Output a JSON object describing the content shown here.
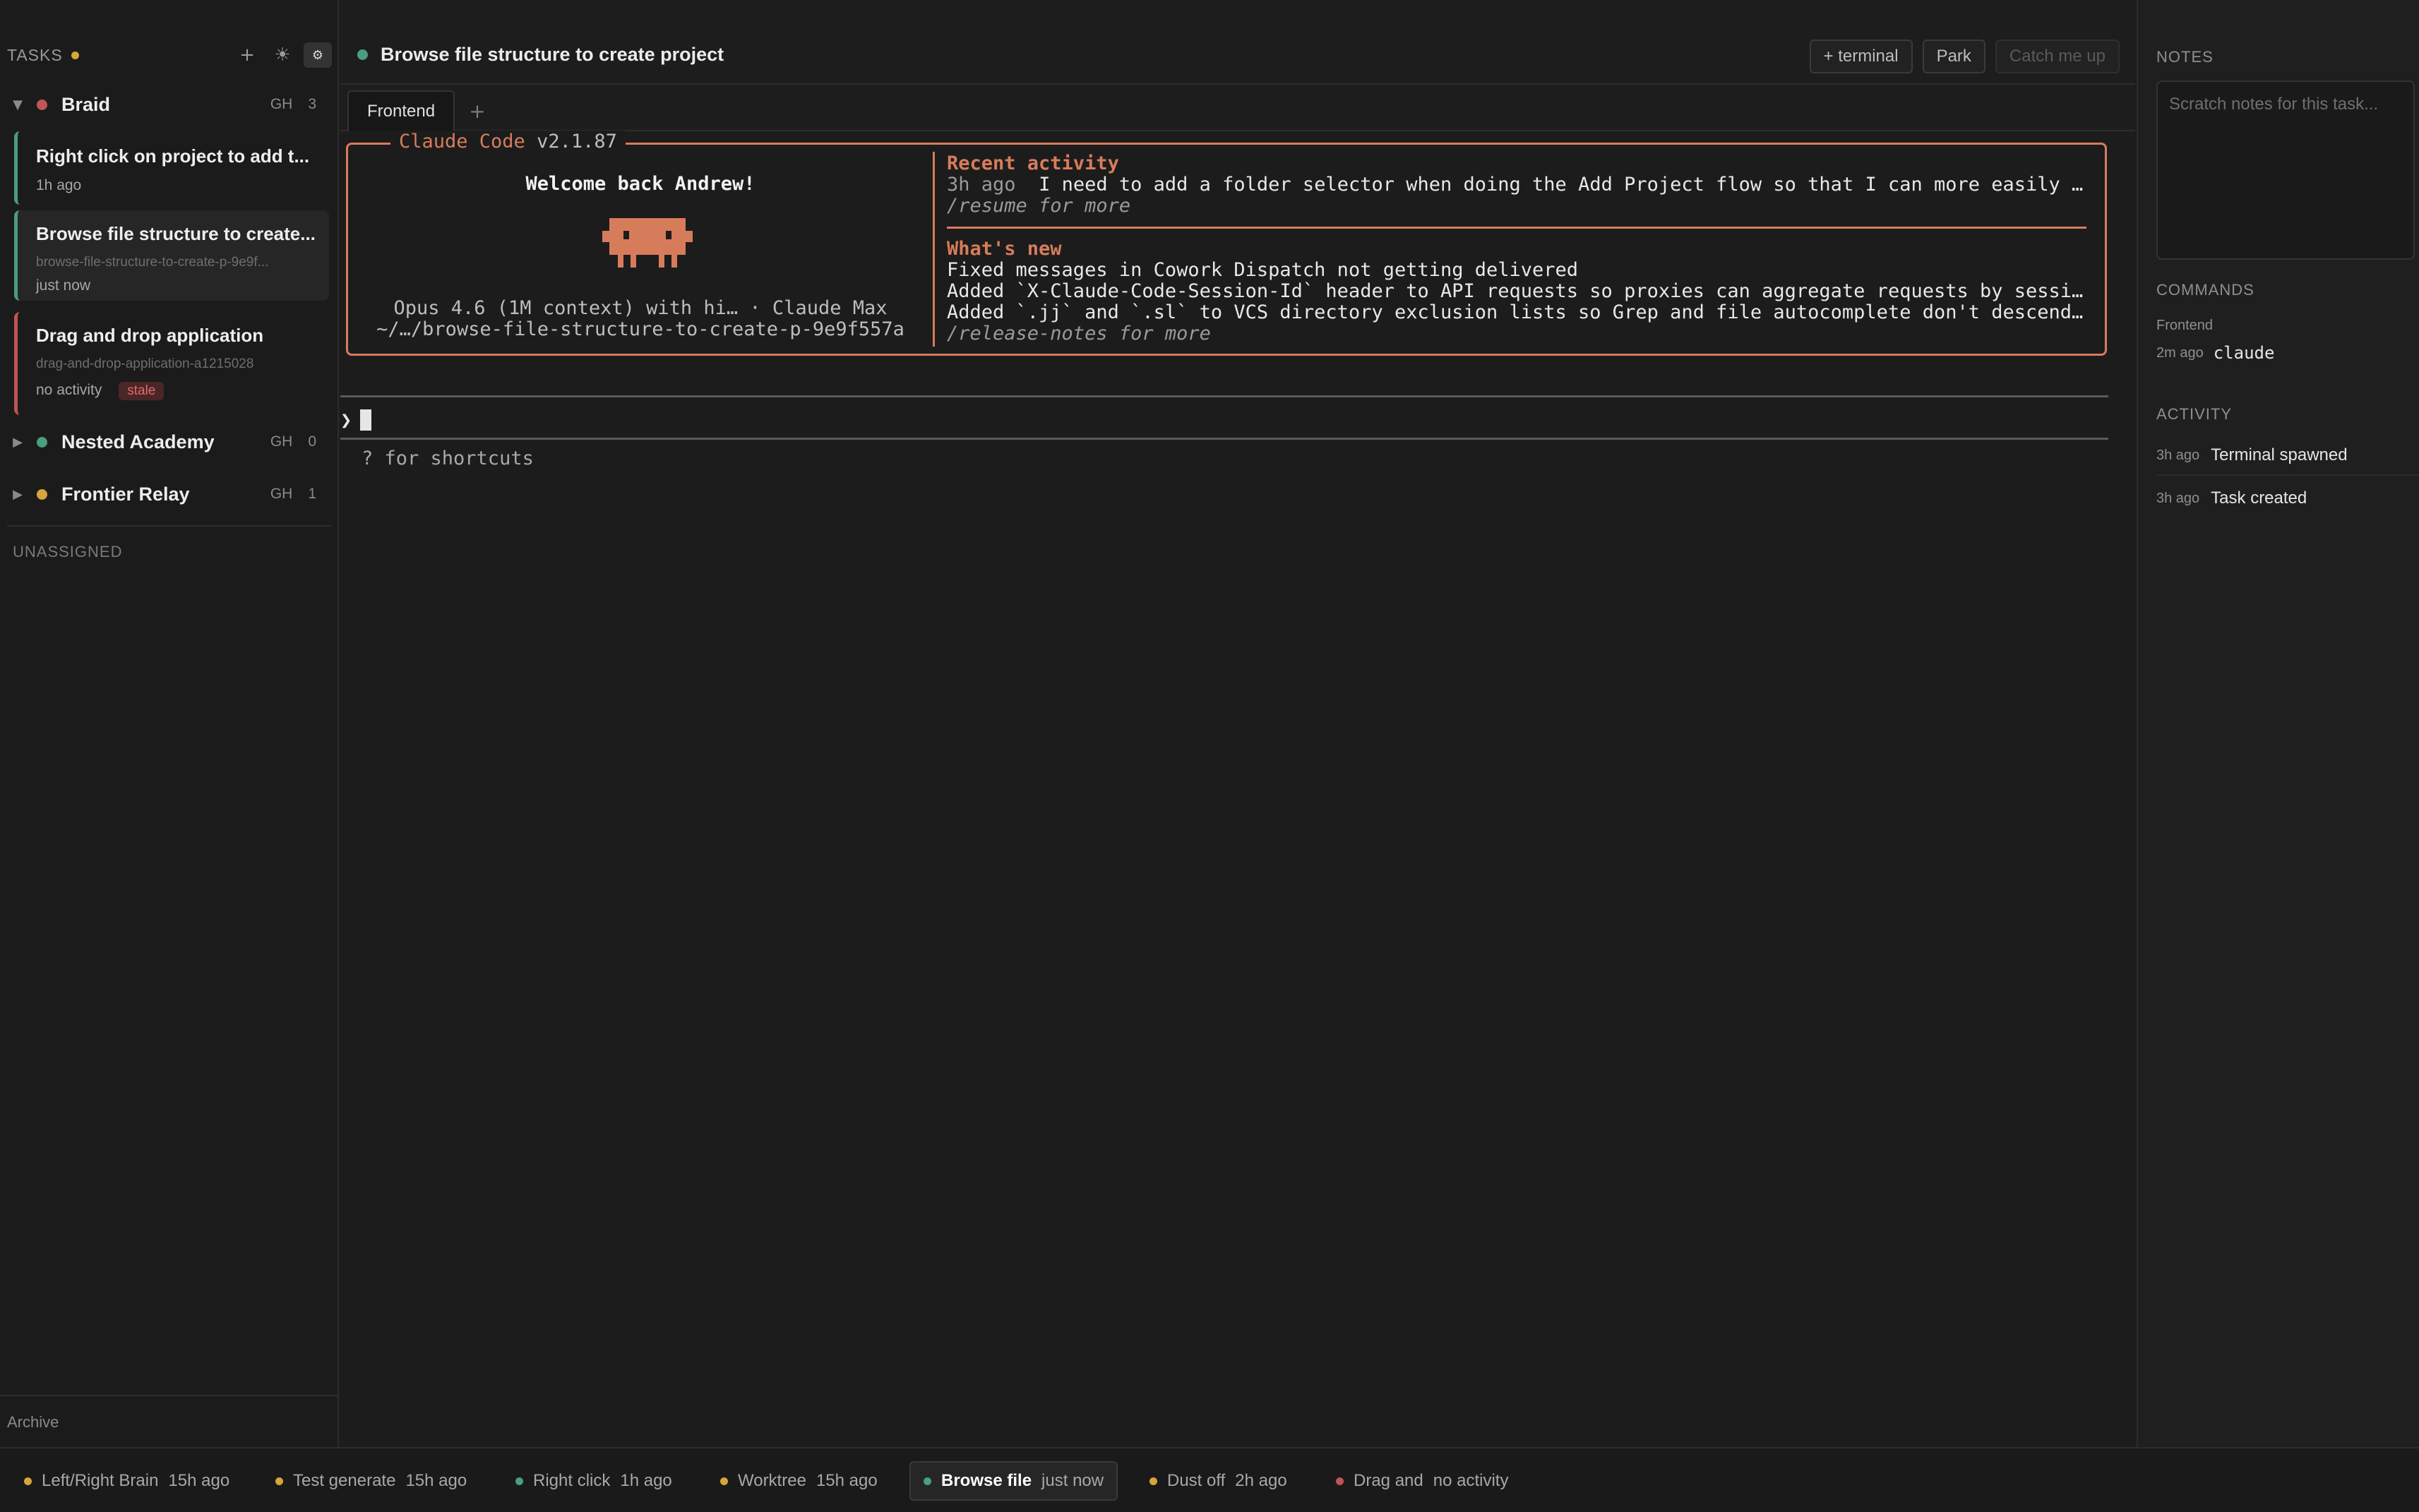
{
  "colors": {
    "accent": "#d77c5b",
    "green": "#4b9e7d",
    "red": "#c05555",
    "amber": "#d9a43c"
  },
  "sidebar": {
    "title": "TASKS",
    "actions": {
      "add_icon": "plus-icon",
      "theme_icon": "sun-icon",
      "settings_icon": "gear-icon"
    },
    "projects": [
      {
        "name": "Braid",
        "gh": "GH",
        "count": "3",
        "expanded": true,
        "tasks": [
          {
            "name": "Right click on project to add t...",
            "slug": "",
            "time": "1h ago"
          },
          {
            "name": "Browse file structure to create...",
            "slug": "browse-file-structure-to-create-p-9e9f...",
            "time": "just now"
          },
          {
            "name": "Drag and drop application",
            "slug": "drag-and-drop-application-a1215028",
            "time": "no activity",
            "badge": "stale"
          }
        ]
      },
      {
        "name": "Nested Academy",
        "gh": "GH",
        "count": "0",
        "expanded": false
      },
      {
        "name": "Frontier Relay",
        "gh": "GH",
        "count": "1",
        "expanded": false
      }
    ],
    "unassigned": "UNASSIGNED",
    "archive": "Archive"
  },
  "main": {
    "task_title": "Browse file structure to create project",
    "buttons": {
      "terminal": "+ terminal",
      "park": "Park",
      "catch_up": "Catch me up"
    },
    "tabs": [
      {
        "label": "Frontend"
      }
    ],
    "tab_add": "+",
    "terminal": {
      "app_name": "Claude Code",
      "version": "v2.1.87",
      "welcome": "Welcome back Andrew!",
      "model": "Opus 4.6 (1M context) with hi… · Claude Max",
      "path": "~/…/browse-file-structure-to-create-p-9e9f557a",
      "recent_heading": "Recent activity",
      "recent_time": "3h ago",
      "recent_text": "I need to add a folder selector when doing the Add Project flow so that I can more easily set …",
      "resume_hint": "/resume for more",
      "whats_new_heading": "What's new",
      "news": [
        "Fixed messages in Cowork Dispatch not getting delivered",
        "Added `X-Claude-Code-Session-Id` header to API requests so proxies can aggregate requests by session w…",
        "Added `.jj` and `.sl` to VCS directory exclusion lists so Grep and file autocomplete don't descend int…"
      ],
      "release_hint": "/release-notes for more",
      "prompt_symbol": "❯",
      "shortcuts": "? for shortcuts"
    }
  },
  "right": {
    "notes_label": "NOTES",
    "notes_placeholder": "Scratch notes for this task...",
    "commands_label": "COMMANDS",
    "command_group": "Frontend",
    "command": {
      "time": "2m ago",
      "cmd": "claude"
    },
    "activity_label": "ACTIVITY",
    "activity": [
      {
        "time": "3h ago",
        "event": "Terminal spawned"
      },
      {
        "time": "3h ago",
        "event": "Task created"
      }
    ]
  },
  "bottombar": {
    "items": [
      {
        "name": "Left/Right Brain",
        "time": "15h ago",
        "color": "#d9a43c"
      },
      {
        "name": "Test generate",
        "time": "15h ago",
        "color": "#d9a43c"
      },
      {
        "name": "Right click",
        "time": "1h ago",
        "color": "#4b9e7d"
      },
      {
        "name": "Worktree",
        "time": "15h ago",
        "color": "#d9a43c"
      },
      {
        "name": "Browse file",
        "time": "just now",
        "color": "#4b9e7d",
        "active": true
      },
      {
        "name": "Dust off",
        "time": "2h ago",
        "color": "#d9a43c"
      },
      {
        "name": "Drag and",
        "time": "no activity",
        "color": "#c05555"
      }
    ]
  }
}
